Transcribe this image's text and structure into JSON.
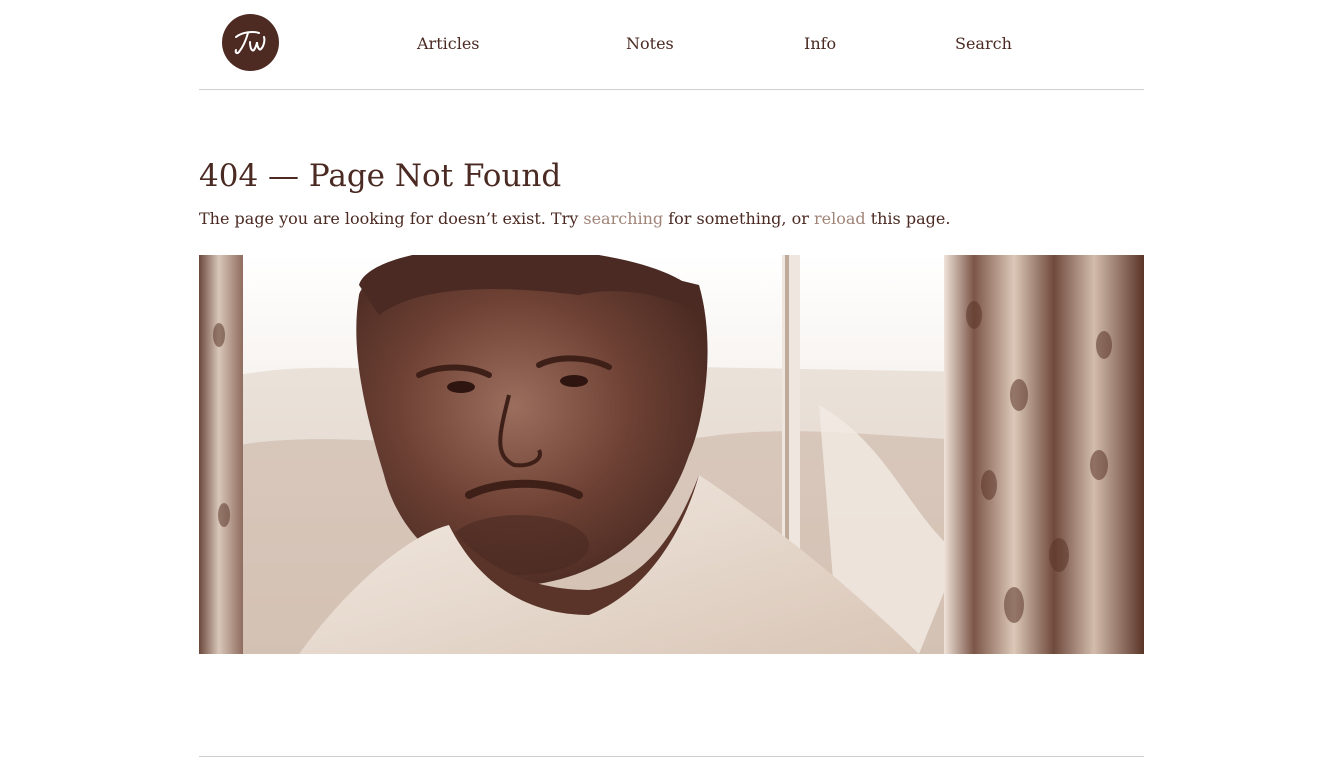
{
  "site": {
    "logo_text": "TW"
  },
  "nav": {
    "items": [
      {
        "label": "Articles"
      },
      {
        "label": "Notes"
      },
      {
        "label": "Info"
      },
      {
        "label": "Search"
      }
    ]
  },
  "content": {
    "heading": "404 — Page Not Found",
    "message": {
      "before": "The page you are looking for doesn’t exist. Try ",
      "link1": "searching",
      "middle": " for something, or ",
      "link2": "reload",
      "after": " this page."
    }
  },
  "colors": {
    "brand": "#4d2a22",
    "text": "#4a2a22",
    "link": "#a08478",
    "rule": "#cfcfcf"
  },
  "icons": {
    "logo": "tw-monogram-icon"
  }
}
